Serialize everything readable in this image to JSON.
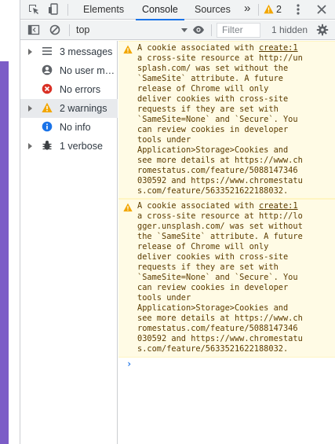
{
  "tabs": {
    "elements": "Elements",
    "console": "Console",
    "sources": "Sources",
    "more": "»",
    "warning_count": "2"
  },
  "toolbar": {
    "context": "top",
    "filter_placeholder": "Filter",
    "hidden": "1 hidden"
  },
  "sidebar": {
    "items": [
      {
        "label": "3 messages",
        "icon": "list-icon"
      },
      {
        "label": "No user me…",
        "icon": "user-icon"
      },
      {
        "label": "No errors",
        "icon": "error-icon"
      },
      {
        "label": "2 warnings",
        "icon": "warning-icon"
      },
      {
        "label": "No info",
        "icon": "info-icon"
      },
      {
        "label": "1 verbose",
        "icon": "bug-icon"
      }
    ]
  },
  "messages": [
    {
      "source": "create:1",
      "lines": [
        "A cookie associated with ",
        "a cross-site resource at http://un",
        "splash.com/ was set without the",
        "`SameSite` attribute. A future",
        "release of Chrome will only",
        "deliver cookies with cross-site",
        "requests if they are set with",
        "`SameSite=None` and `Secure`. You",
        "can review cookies in developer",
        "tools under",
        "Application>Storage>Cookies and",
        "see more details at https://www.ch",
        "romestatus.com/feature/5088147346",
        "030592 and https://www.chromestatu",
        "s.com/feature/5633521622188032."
      ]
    },
    {
      "source": "create:1",
      "lines": [
        "A cookie associated with ",
        "a cross-site resource at http://lo",
        "gger.unsplash.com/ was set without",
        "the `SameSite` attribute. A future",
        "release of Chrome will only",
        "deliver cookies with cross-site",
        "requests if they are set with",
        "`SameSite=None` and `Secure`. You",
        "can review cookies in developer",
        "tools under",
        "Application>Storage>Cookies and",
        "see more details at https://www.ch",
        "romestatus.com/feature/5088147346",
        "030592 and https://www.chromestatu",
        "s.com/feature/5633521622188032."
      ]
    }
  ],
  "prompt": "›",
  "colors": {
    "accent": "#1a73e8",
    "warning_bg": "#fffbe5",
    "warning_text": "#5c3c00",
    "warning_icon": "#f2a600",
    "error_icon": "#d93025",
    "info_icon": "#1a73e8",
    "sidebar_panel": "#7c5dc7"
  }
}
